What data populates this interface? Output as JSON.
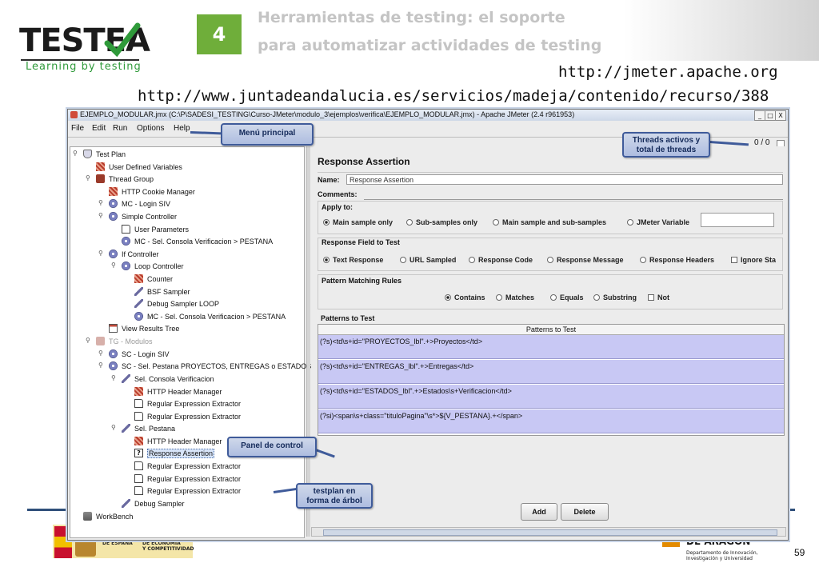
{
  "slide": {
    "logo_text": "TESTEA",
    "logo_tagline": "Learning by testing",
    "section_number": "4",
    "title_line1": "Herramientas de testing: el soporte",
    "title_line2": "para automatizar actividades de testing",
    "url1": "http://jmeter.apache.org",
    "url2": "http://www.juntadeandalucia.es/servicios/madeja/contenido/recurso/388",
    "page_number": "59",
    "footer_left_1": "DE ESPAÑA",
    "footer_left_2a": "DE ECONOMÍA",
    "footer_left_2b": "Y COMPETITIVIDAD",
    "footer_right_1": "DE ARAGON",
    "footer_right_2a": "Departamento de Innovación,",
    "footer_right_2b": "Investigación y Universidad"
  },
  "window": {
    "title": "EJEMPLO_MODULAR.jmx (C:\\P\\SADESI_TESTING\\Curso-JMeter\\modulo_3\\ejemplos\\verifica\\EJEMPLO_MODULAR.jmx) - Apache JMeter (2.4 r961953)",
    "minimize": "_",
    "maximize": "□",
    "close": "X",
    "menu": [
      "File",
      "Edit",
      "Run",
      "Options",
      "Help"
    ],
    "thread_count": "0 / 0"
  },
  "tree": {
    "nodes": [
      "Test Plan",
      "User Defined Variables",
      "Thread Group",
      "HTTP Cookie Manager",
      "MC - Login SIV",
      "Simple Controller",
      "User Parameters",
      "MC - Sel. Consola Verificacion > PESTANA",
      "If Controller",
      "Loop Controller",
      "Counter",
      "BSF Sampler",
      "Debug Sampler LOOP",
      "MC - Sel. Consola Verificacion > PESTANA",
      "View Results Tree",
      "TG - Modulos",
      "SC - Login SIV",
      "SC - Sel. Pestana PROYECTOS, ENTREGAS o ESTADOS",
      "Sel. Consola Verificacion",
      "HTTP Header Manager",
      "Regular Expression Extractor",
      "Regular Expression Extractor",
      "Sel. Pestana",
      "HTTP Header Manager",
      "Response Assertion",
      "Regular Expression Extractor",
      "Regular Expression Extractor",
      "Regular Expression Extractor",
      "Debug Sampler",
      "WorkBench"
    ]
  },
  "panel": {
    "heading": "Response Assertion",
    "name_label": "Name:",
    "name_value": "Response Assertion",
    "comments_label": "Comments:",
    "apply_to_label": "Apply to:",
    "apply_to_options": [
      "Main sample only",
      "Sub-samples only",
      "Main sample and sub-samples",
      "JMeter Variable"
    ],
    "field_label": "Response Field to Test",
    "field_options": [
      "Text Response",
      "URL Sampled",
      "Response Code",
      "Response Message",
      "Response Headers"
    ],
    "ignore_status": "Ignore Sta",
    "rules_label": "Pattern Matching Rules",
    "rules_options": [
      "Contains",
      "Matches",
      "Equals",
      "Substring"
    ],
    "not_label": "Not",
    "patterns_label": "Patterns to Test",
    "patterns_header": "Patterns to Test",
    "patterns": [
      "(?s)<td\\s+id=\"PROYECTOS_lbl\".+>Proyectos</td>",
      "(?s)<td\\s+id=\"ENTREGAS_lbl\".+>Entregas</td>",
      "(?s)<td\\s+id=\"ESTADOS_lbl\".+>Estados\\s+Verificacion</td>",
      "(?si)<span\\s+class=\"tituloPagina\"\\s*>${V_PESTANA}.+</span>"
    ],
    "add_button": "Add",
    "delete_button": "Delete"
  },
  "callouts": {
    "menu": "Menú principal",
    "threads_l1": "Threads activos y",
    "threads_l2": "total de threads",
    "control_panel": "Panel de control",
    "tree_l1": "testplan en",
    "tree_l2": "forma de árbol"
  },
  "colors": {
    "accent_green": "#6fae3a",
    "callout_border": "#3f5b9a",
    "pattern_row": "#c8c8f4"
  }
}
